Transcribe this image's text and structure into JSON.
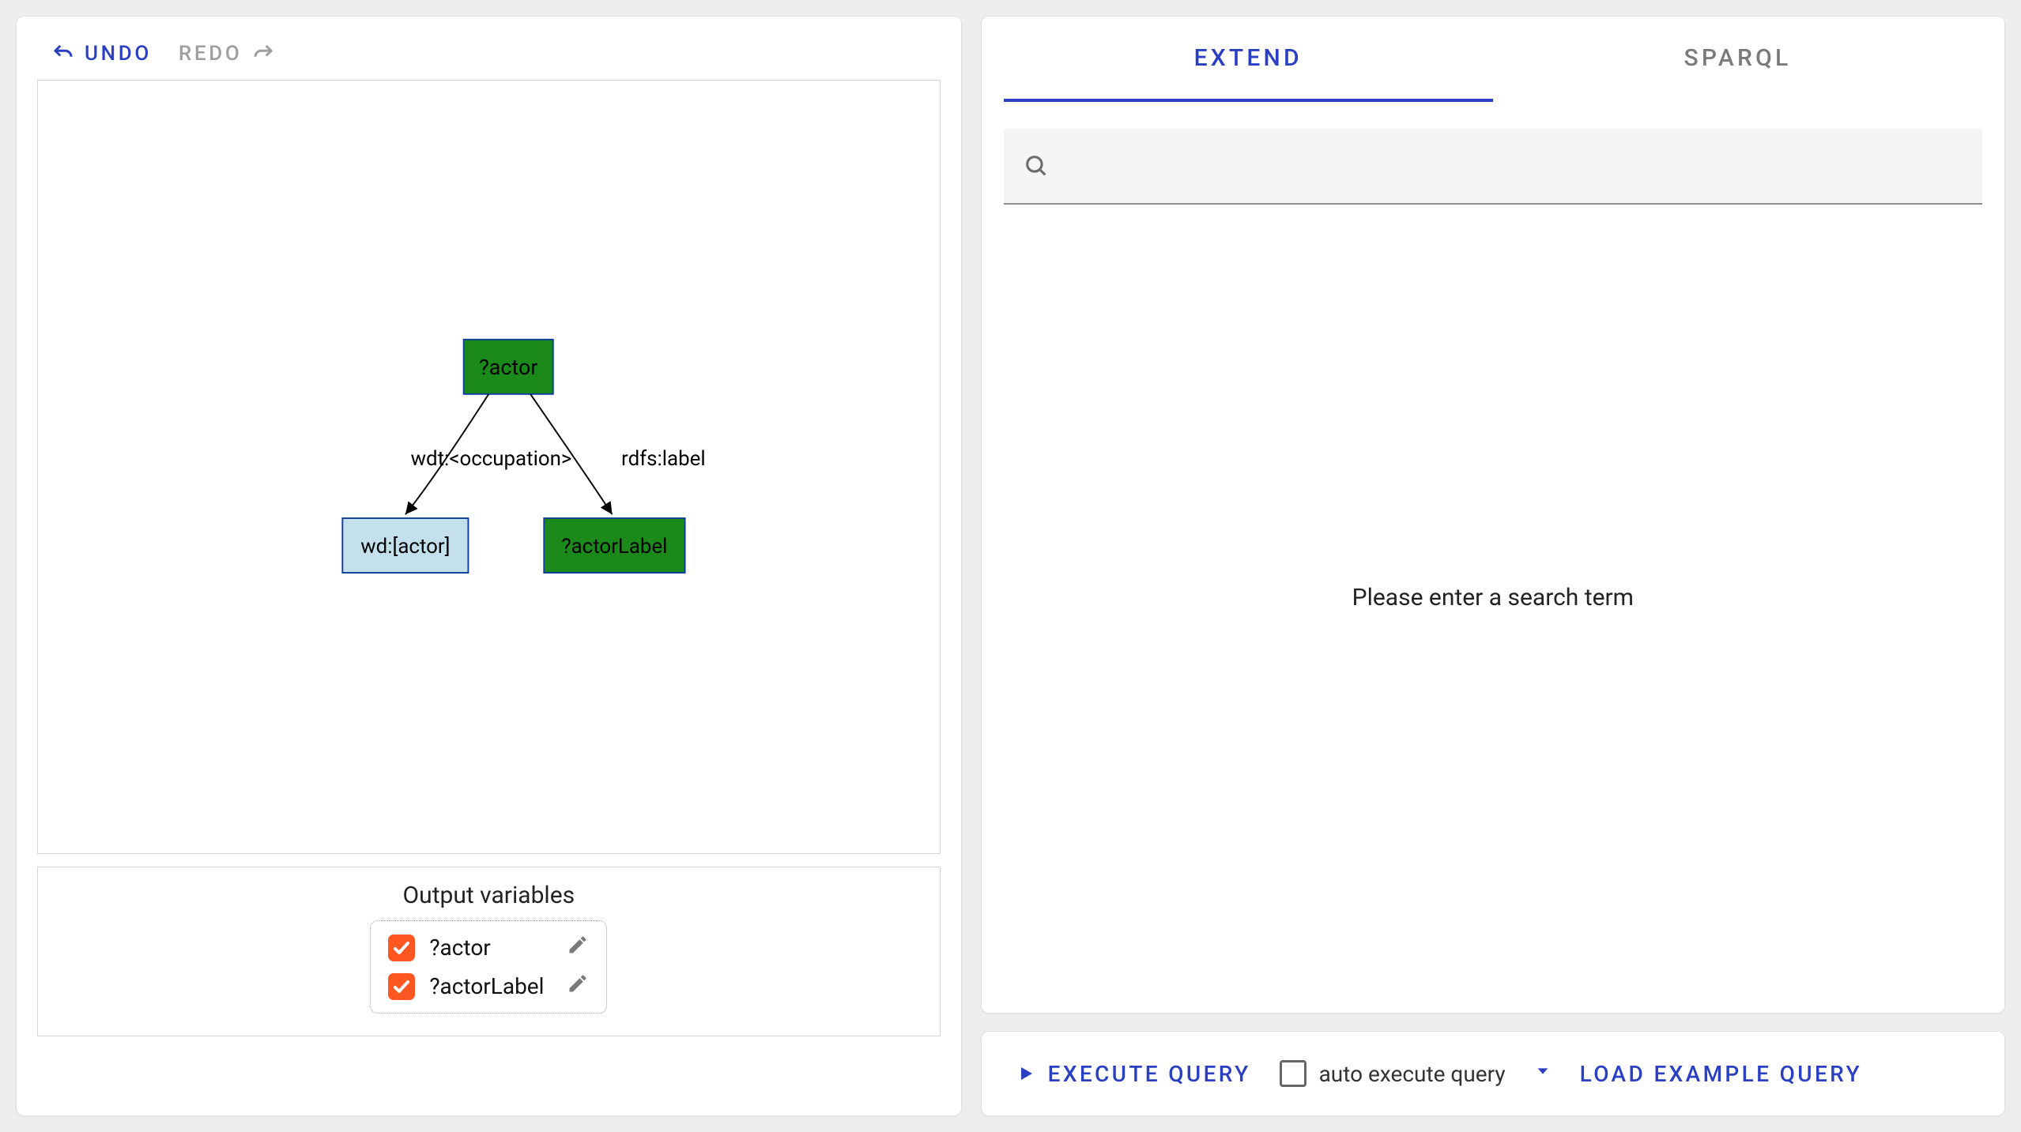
{
  "left": {
    "undo": "UNDO",
    "redo": "REDO",
    "graph": {
      "root": {
        "label": "?actor"
      },
      "edge1": {
        "label": "wdt:<occupation>"
      },
      "edge2": {
        "label": "rdfs:label"
      },
      "leaf1": {
        "label": "wd:[actor]"
      },
      "leaf2": {
        "label": "?actorLabel"
      }
    },
    "output": {
      "title": "Output variables",
      "vars": [
        {
          "name": "?actor",
          "checked": true
        },
        {
          "name": "?actorLabel",
          "checked": true
        }
      ]
    }
  },
  "right": {
    "tabs": {
      "extend": "EXTEND",
      "sparql": "SPARQL",
      "active": "extend"
    },
    "search_placeholder": "",
    "empty_msg": "Please enter a search term",
    "footer": {
      "execute": "EXECUTE QUERY",
      "auto": "auto execute query",
      "load": "LOAD EXAMPLE QUERY"
    }
  }
}
